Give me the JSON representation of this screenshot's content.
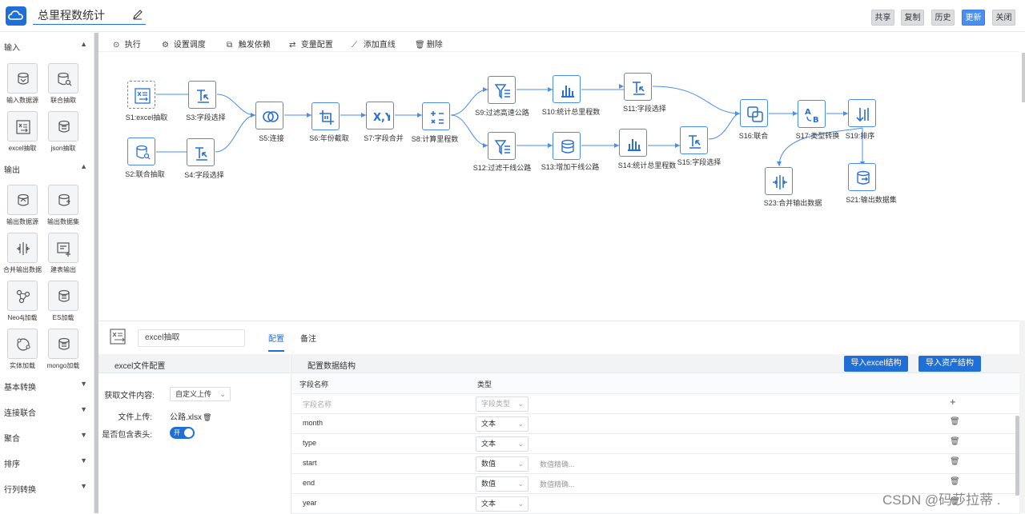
{
  "header": {
    "title": "总里程数统计",
    "buttons": [
      "共享",
      "复制",
      "历史",
      "更新",
      "关闭"
    ],
    "accent_color": "#1f6fd6"
  },
  "sidebar": {
    "sections": [
      {
        "label": "输入",
        "expanded": true
      },
      {
        "label": "输出",
        "expanded": true
      },
      {
        "label": "基本转换",
        "expanded": false
      },
      {
        "label": "连接联合",
        "expanded": false
      },
      {
        "label": "聚合",
        "expanded": false
      },
      {
        "label": "排序",
        "expanded": false
      },
      {
        "label": "行列转换",
        "expanded": false
      }
    ],
    "input_tiles": [
      "输入数据源",
      "联合抽取",
      "excel抽取",
      "json抽取"
    ],
    "output_tiles": [
      "输出数据源",
      "输出数据集",
      "合并输出数据",
      "建表输出",
      "Neo4j加载",
      "ES加载",
      "实体加载",
      "mongo加载"
    ]
  },
  "toolbar": [
    "执行",
    "设置调度",
    "触发依赖",
    "变量配置",
    "添加直线",
    "删除"
  ],
  "flow": {
    "nodes": [
      {
        "id": "S1",
        "label": "S1:excel抽取",
        "icon": "excel-icon",
        "selected": true
      },
      {
        "id": "S2",
        "label": "S2:联合抽取",
        "icon": "database-icon"
      },
      {
        "id": "S3",
        "label": "S3:字段选择",
        "icon": "field-select-icon"
      },
      {
        "id": "S4",
        "label": "S4:字段选择",
        "icon": "field-select-icon"
      },
      {
        "id": "S5",
        "label": "S5:连接",
        "icon": "join-icon"
      },
      {
        "id": "S6",
        "label": "S6:年份截取",
        "icon": "crop-icon"
      },
      {
        "id": "S7",
        "label": "S7:字段合并",
        "icon": "merge-xy-icon"
      },
      {
        "id": "S8",
        "label": "S8:计算里程数",
        "icon": "calculator-icon"
      },
      {
        "id": "S9",
        "label": "S9:过滤高速公路",
        "icon": "filter-icon"
      },
      {
        "id": "S10",
        "label": "S10:统计总里程数",
        "icon": "bar-chart-icon"
      },
      {
        "id": "S11",
        "label": "S11:字段选择",
        "icon": "field-select-icon"
      },
      {
        "id": "S12",
        "label": "S12:过滤干线公路",
        "icon": "filter-icon"
      },
      {
        "id": "S13",
        "label": "S13:增加干线公路",
        "icon": "database-icon"
      },
      {
        "id": "S14",
        "label": "S14:统计总里程数",
        "icon": "bar-chart-icon"
      },
      {
        "id": "S15",
        "label": "S15:字段选择",
        "icon": "field-select-icon"
      },
      {
        "id": "S16",
        "label": "S16:联合",
        "icon": "union-icon"
      },
      {
        "id": "S17",
        "label": "S17:类型转换",
        "icon": "type-convert-icon"
      },
      {
        "id": "S19",
        "label": "S19:排序",
        "icon": "sort-icon"
      },
      {
        "id": "S21",
        "label": "S21:输出数据集",
        "icon": "dataset-output-icon"
      },
      {
        "id": "S23",
        "label": "S23:合并输出数据",
        "icon": "merge-output-icon"
      }
    ]
  },
  "bottom": {
    "step_name": "excel抽取",
    "tabs": [
      "配置",
      "备注"
    ],
    "left_panel": {
      "title": "excel文件配置",
      "fields": {
        "content_label": "获取文件内容:",
        "content_value": "自定义上传",
        "upload_label": "文件上传:",
        "upload_value": "公路.xlsx",
        "header_label": "是否包含表头:",
        "header_toggle": "开"
      }
    },
    "right_panel": {
      "title": "配置数据结构",
      "buttons": [
        "导入excel结构",
        "导入资产结构"
      ],
      "columns": [
        "字段名称",
        "类型"
      ],
      "placeholder_name": "字段名称",
      "placeholder_type": "字段类型",
      "add_icon": "+",
      "rows": [
        {
          "name": "month",
          "type": "文本",
          "precision": ""
        },
        {
          "name": "type",
          "type": "文本",
          "precision": ""
        },
        {
          "name": "start",
          "type": "数值",
          "precision": "数值精确..."
        },
        {
          "name": "end",
          "type": "数值",
          "precision": "数值精确..."
        },
        {
          "name": "year",
          "type": "文本",
          "precision": ""
        }
      ]
    }
  },
  "watermark": "CSDN @码莎拉蒂 ."
}
